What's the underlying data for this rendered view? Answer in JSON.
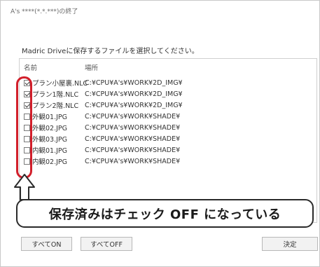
{
  "window": {
    "title": "A's ****(*.*.***)の終了"
  },
  "instruction": "Madric Driveに保存するファイルを選択してください。",
  "table": {
    "headers": {
      "name": "名前",
      "location": "場所"
    },
    "rows": [
      {
        "name": "プラン小屋裏.NLC",
        "location": "C:¥CPU¥A's¥WORK¥2D_IMG¥",
        "checked": true
      },
      {
        "name": "プラン1階.NLC",
        "location": "C:¥CPU¥A's¥WORK¥2D_IMG¥",
        "checked": true
      },
      {
        "name": "プラン2階.NLC",
        "location": "C:¥CPU¥A's¥WORK¥2D_IMG¥",
        "checked": true
      },
      {
        "name": "外観01.JPG",
        "location": "C:¥CPU¥A's¥WORK¥SHADE¥",
        "checked": false
      },
      {
        "name": "外観02.JPG",
        "location": "C:¥CPU¥A's¥WORK¥SHADE¥",
        "checked": false
      },
      {
        "name": "外観03.JPG",
        "location": "C:¥CPU¥A's¥WORK¥SHADE¥",
        "checked": false
      },
      {
        "name": "内観01.JPG",
        "location": "C:¥CPU¥A's¥WORK¥SHADE¥",
        "checked": false
      },
      {
        "name": "内観02.JPG",
        "location": "C:¥CPU¥A's¥WORK¥SHADE¥",
        "checked": false
      }
    ]
  },
  "callout": "保存済みはチェック OFF になっている",
  "buttons": {
    "all_on": "すべてON",
    "all_off": "すべてOFF",
    "ok": "決定"
  },
  "colors": {
    "highlight": "#d21f2b"
  }
}
